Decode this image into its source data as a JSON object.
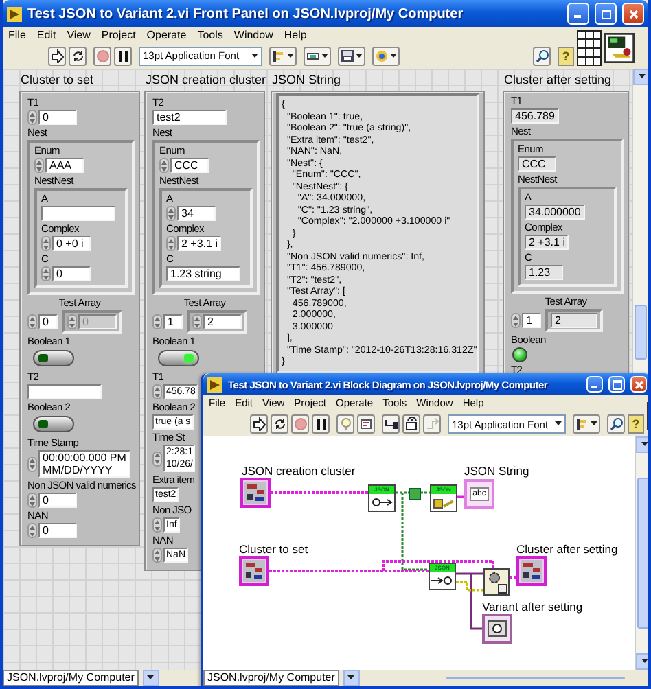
{
  "front_panel": {
    "title": "Test JSON to Variant 2.vi Front Panel on JSON.lvproj/My Computer",
    "menu": [
      "File",
      "Edit",
      "View",
      "Project",
      "Operate",
      "Tools",
      "Window",
      "Help"
    ],
    "toolbar": {
      "font": "13pt Application Font",
      "help": "?"
    },
    "panels": [
      {
        "kind": "cluster",
        "label": "Cluster to set",
        "indicator": false,
        "controls": [
          {
            "kind": "numeric",
            "label": "T1",
            "value": "0"
          },
          {
            "kind": "cluster",
            "label": "Nest",
            "children": [
              {
                "kind": "numeric",
                "label": "Enum",
                "value": "AAA"
              },
              {
                "kind": "cluster",
                "label": "NestNest",
                "children": [
                  {
                    "kind": "string",
                    "label": "A"
                  },
                  {
                    "kind": "numeric",
                    "label": "Complex",
                    "value": "0 +0 i"
                  },
                  {
                    "kind": "numeric",
                    "label": "C",
                    "value": "0"
                  }
                ]
              }
            ]
          },
          {
            "kind": "array",
            "label": "Test Array",
            "index": "0",
            "elements": [
              {
                "value": "0",
                "disabled": true
              }
            ]
          },
          {
            "kind": "switch",
            "label": "Boolean 1",
            "on": false
          },
          {
            "kind": "string",
            "label": "T2"
          },
          {
            "kind": "switch",
            "label": "Boolean 2",
            "on": false
          },
          {
            "kind": "timestamp",
            "label": "Time Stamp",
            "lines": [
              "00:00:00.000 PM",
              "MM/DD/YYYY"
            ]
          },
          {
            "kind": "numeric",
            "label": "Non JSON valid numerics",
            "value": "0"
          },
          {
            "kind": "numeric",
            "label": "NAN",
            "value": "0"
          }
        ]
      },
      {
        "kind": "cluster",
        "label": "JSON creation cluster",
        "indicator": false,
        "controls": [
          {
            "kind": "string",
            "label": "T2",
            "value": "test2"
          },
          {
            "kind": "cluster",
            "label": "Nest",
            "children": [
              {
                "kind": "numeric",
                "label": "Enum",
                "value": "CCC"
              },
              {
                "kind": "cluster",
                "label": "NestNest",
                "children": [
                  {
                    "kind": "numeric",
                    "label": "A",
                    "value": "34"
                  },
                  {
                    "kind": "numeric",
                    "label": "Complex",
                    "value": "2 +3.1 i"
                  },
                  {
                    "kind": "string",
                    "label": "C",
                    "value": "1.23 string"
                  }
                ]
              }
            ]
          },
          {
            "kind": "array",
            "label": "Test Array",
            "index": "1",
            "elements": [
              {
                "value": "2",
                "disabled": false
              }
            ]
          },
          {
            "kind": "switch",
            "label": "Boolean 1",
            "on": true
          },
          {
            "kind": "numeric",
            "label": "T1",
            "value": "456.78"
          },
          {
            "kind": "string",
            "label": "Boolean 2",
            "value": "true (a s"
          },
          {
            "kind": "timestamp",
            "label": "Time St",
            "lines": [
              "2:28:1",
              "10/26/"
            ]
          },
          {
            "kind": "string",
            "label": "Extra item",
            "value": "test2"
          },
          {
            "kind": "numeric",
            "label": "Non JSO",
            "value": "Inf"
          },
          {
            "kind": "numeric",
            "label": "NAN",
            "value": "NaN"
          }
        ]
      },
      {
        "kind": "string",
        "label": "JSON String",
        "text": "{\n  \"Boolean 1\": true,\n  \"Boolean 2\": \"true (a string)\",\n  \"Extra item\": \"test2\",\n  \"NAN\": NaN,\n  \"Nest\": {\n    \"Enum\": \"CCC\",\n    \"NestNest\": {\n      \"A\": 34.000000,\n      \"C\": \"1.23 string\",\n      \"Complex\": \"2.000000 +3.100000 i\"\n    }\n  },\n  \"Non JSON valid numerics\": Inf,\n  \"T1\": 456.789000,\n  \"T2\": \"test2\",\n  \"Test Array\": [\n    456.789000,\n    2.000000,\n    3.000000\n  ],\n  \"Time Stamp\": \"2012-10-26T13:28:16.312Z\"\n}"
      },
      {
        "kind": "cluster",
        "label": "Cluster after setting",
        "indicator": true,
        "controls": [
          {
            "kind": "numeric",
            "label": "T1",
            "value": "456.789"
          },
          {
            "kind": "cluster",
            "label": "Nest",
            "children": [
              {
                "kind": "numeric",
                "label": "Enum",
                "value": "CCC"
              },
              {
                "kind": "cluster",
                "label": "NestNest",
                "children": [
                  {
                    "kind": "numeric",
                    "label": "A",
                    "value": "34.000000"
                  },
                  {
                    "kind": "numeric",
                    "label": "Complex",
                    "value": "2 +3.1 i"
                  },
                  {
                    "kind": "numeric",
                    "label": "C",
                    "value": "1.23"
                  }
                ]
              }
            ]
          },
          {
            "kind": "array",
            "label": "Test Array",
            "index": "1",
            "elements": [
              {
                "value": "2",
                "disabled": false
              }
            ]
          },
          {
            "kind": "led",
            "label": "Boolean",
            "on": true
          },
          {
            "kind": "label",
            "label": "T2"
          }
        ]
      }
    ],
    "status": "JSON.lvproj/My Computer"
  },
  "block_diagram": {
    "title": "Test JSON to Variant 2.vi Block Diagram on JSON.lvproj/My Computer",
    "menu": [
      "File",
      "Edit",
      "View",
      "Project",
      "Operate",
      "Tools",
      "Window",
      "Help"
    ],
    "toolbar": {
      "font": "13pt Application Font",
      "help": "?"
    },
    "nodes": [
      {
        "kind": "cluster_terminal",
        "label": "JSON creation cluster"
      },
      {
        "kind": "cluster_terminal",
        "label": "Cluster to set"
      },
      {
        "kind": "function",
        "header": "JSON"
      },
      {
        "kind": "function",
        "header": "JSON"
      },
      {
        "kind": "string_terminal",
        "label": "JSON String",
        "text": "abc"
      },
      {
        "kind": "function",
        "header": "JSON"
      },
      {
        "kind": "set_variant"
      },
      {
        "kind": "cluster_terminal",
        "label": "Cluster after setting"
      },
      {
        "kind": "variant_terminal",
        "label": "Variant after setting"
      }
    ],
    "status": "JSON.lvproj/My Computer"
  }
}
